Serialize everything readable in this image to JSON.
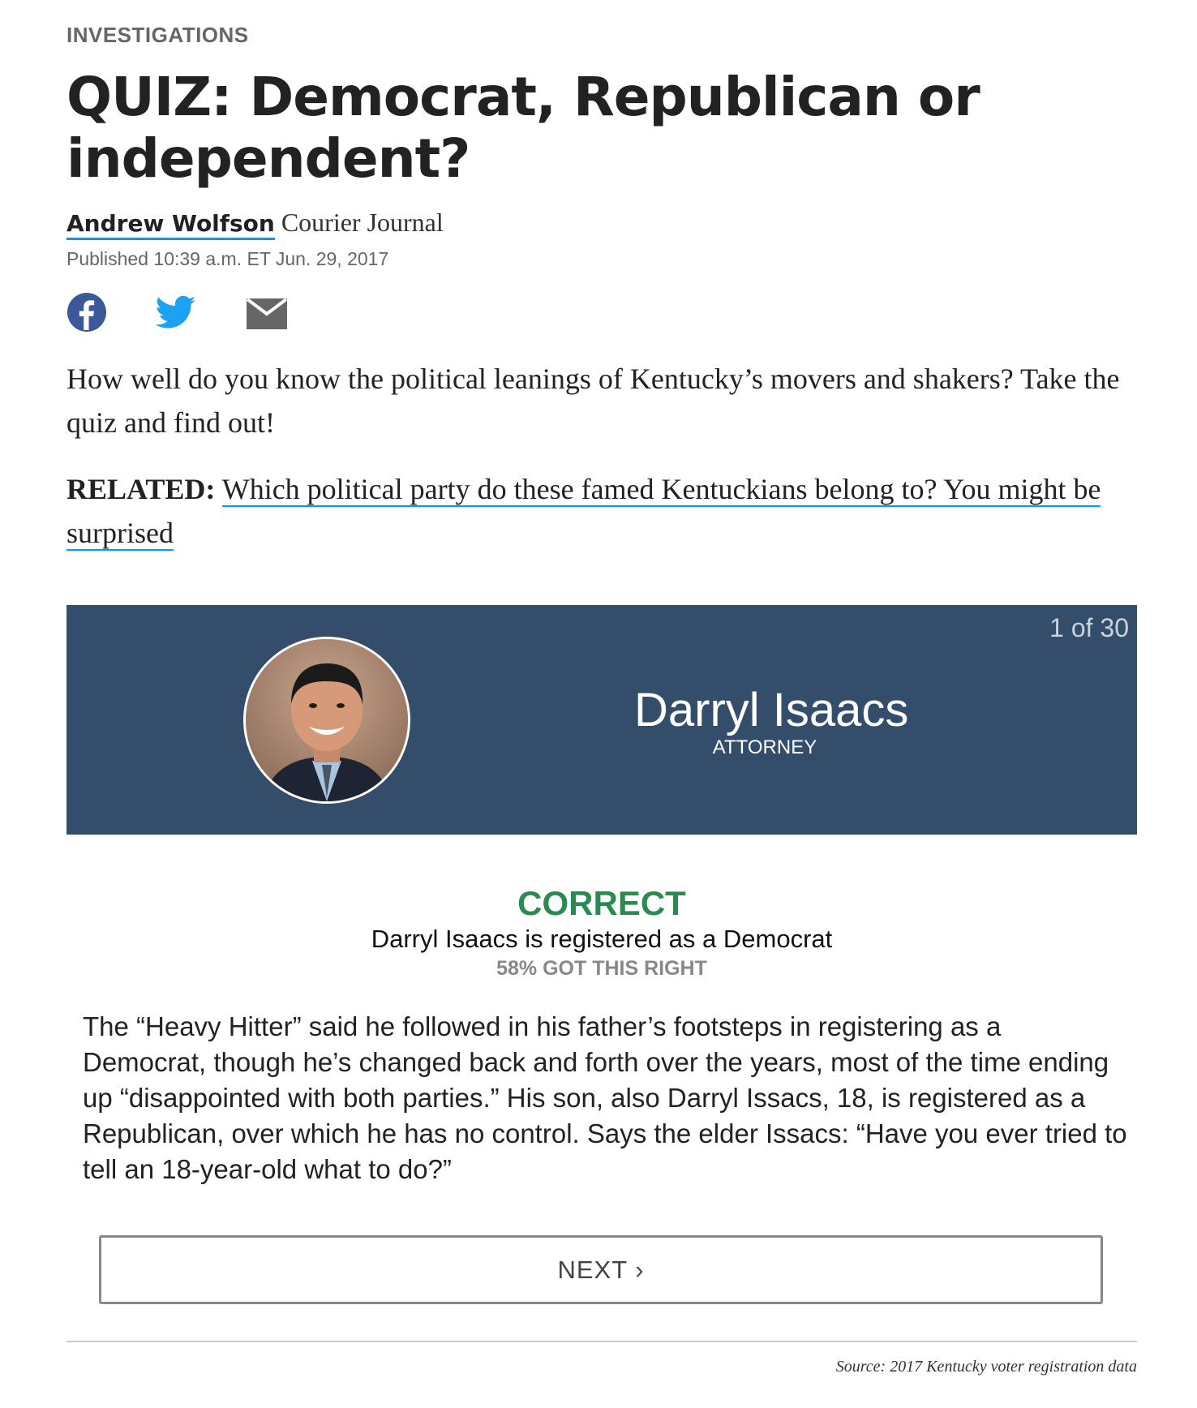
{
  "article": {
    "section": "INVESTIGATIONS",
    "headline": "QUIZ: Democrat, Republican or independent?",
    "author": "Andrew Wolfson",
    "outlet": "Courier Journal",
    "published": "Published 10:39 a.m. ET Jun. 29, 2017",
    "share": {
      "facebook_icon": "facebook-icon",
      "twitter_icon": "twitter-icon",
      "email_icon": "email-icon",
      "facebook_color": "#3b5998",
      "twitter_color": "#1da1f2",
      "email_color": "#666666"
    },
    "intro": "How well do you know the political leanings of Kentucky’s movers and shakers? Take the quiz and find out!",
    "related_label": "RELATED:",
    "related_link": "Which political party do these famed Kentuckians belong to? You might be surprised"
  },
  "quiz": {
    "counter": "1 of 30",
    "card_color": "#344d6b",
    "person_name": "Darryl Isaacs",
    "person_title": "ATTORNEY",
    "result_status": "CORRECT",
    "result_color": "#2a8a4f",
    "result_text": "Darryl Isaacs is registered as a Democrat",
    "result_stat": "58% GOT THIS RIGHT",
    "explanation": "The “Heavy Hitter” said he followed in his father’s footsteps in registering as a Democrat, though he’s changed back and forth over the years, most of the time ending up “disappointed with both parties.” His son, also Darryl Issacs, 18, is registered as a Republican, over which he has no control. Says the elder Issacs: “Have you ever tried to tell an 18-year-old what to do?”",
    "next_label": "NEXT ›",
    "source": "Source: 2017 Kentucky voter registration data"
  }
}
